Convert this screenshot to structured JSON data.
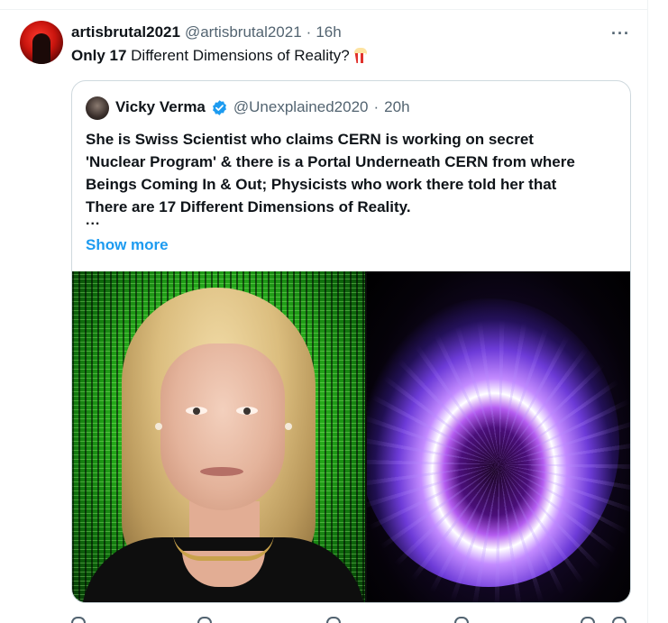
{
  "tweet": {
    "author_name": "artisbrutal2021",
    "handle": "@artisbrutal2021",
    "separator": "·",
    "time": "16h",
    "more_label": "···",
    "text_bold": "Only 17",
    "text_rest": " Different Dimensions of Reality?",
    "emoji": "popcorn-icon"
  },
  "quote": {
    "author_name": "Vicky Verma",
    "handle": "@Unexplained2020",
    "separator": "·",
    "time": "20h",
    "verified": true,
    "lines": [
      "She is Swiss Scientist who claims CERN is working on secret",
      "'Nuclear Program' & there is a Portal Underneath CERN from where",
      "Beings Coming In & Out; Physicists who work there told her that",
      "There are 17 Different Dimensions of Reality."
    ],
    "ellipsis": "...",
    "show_more": "Show more",
    "media": [
      "woman-portrait-matrix-background",
      "purple-portal-vortex"
    ]
  },
  "colors": {
    "link": "#1d9bf0",
    "verified": "#1d9bf0",
    "secondary_text": "#536471",
    "border": "#cfd9de"
  }
}
